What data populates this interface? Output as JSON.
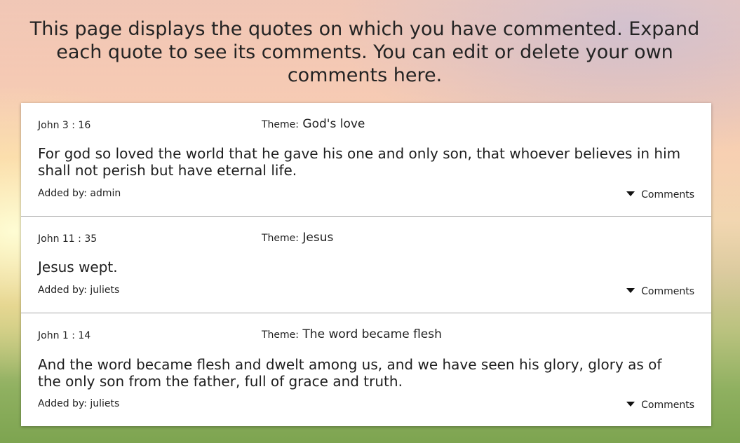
{
  "intro": "This page displays the quotes on which you have commented. Expand each quote to see its comments. You can edit or delete your own comments here.",
  "theme_label": "Theme:",
  "added_by_label": "Added by:",
  "comments_label": "Comments",
  "quotes": [
    {
      "reference": "John 3 : 16",
      "theme": "God's love",
      "text": "For god so loved the world that he gave his one and only son, that whoever believes in him shall not perish but have eternal life.",
      "added_by": "admin"
    },
    {
      "reference": "John 11 : 35",
      "theme": "Jesus",
      "text": "Jesus wept.",
      "added_by": "juliets"
    },
    {
      "reference": "John 1 : 14",
      "theme": "The word became flesh",
      "text": "And the word became flesh and dwelt among us, and we have seen his glory, glory as of the only son from the father, full of grace and truth.",
      "added_by": "juliets"
    }
  ]
}
